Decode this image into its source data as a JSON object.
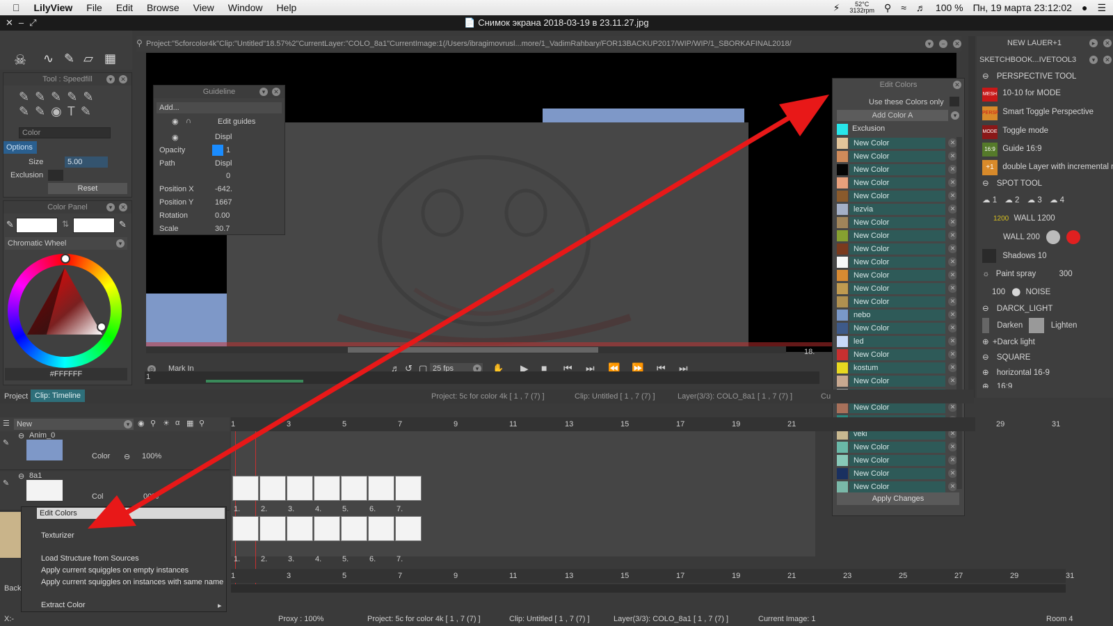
{
  "menubar": {
    "app": "LilyView",
    "menus": [
      "File",
      "Edit",
      "Browse",
      "View",
      "Window",
      "Help"
    ],
    "temp": "52°C",
    "rpm": "3132rpm",
    "battery": "100 %",
    "datetime": "Пн, 19 марта  23:12:02"
  },
  "window": {
    "title": "Снимок экрана 2018-03-19 в 23.11.27.jpg"
  },
  "pathbar": "Project:\"5cforcolor4k\"Clip:\"Untitled\"18.57%2\"CurrentLayer:\"COLO_8a1\"CurrentImage:1(/Users/ibragimovrusl...more/1_VadimRahbary/FOR13BACKUP2017/WIP/WIP/1_SBORKAFINAL2018/",
  "tool_panel": {
    "title": "Tool : Speedfill",
    "color_label": "Color",
    "options": "Options",
    "size_label": "Size",
    "size_value": "5.00",
    "exclusion_label": "Exclusion",
    "reset": "Reset"
  },
  "color_panel": {
    "title": "Color Panel",
    "wheel_mode": "Chromatic Wheel",
    "hex": "#FFFFFF"
  },
  "guideline": {
    "title": "Guideline",
    "add": "Add...",
    "edit_guides": "Edit guides",
    "displ": "Displ",
    "opacity_label": "Opacity",
    "opacity_val": "1",
    "path_label": "Path",
    "path_val": "Displ",
    "zero": "0",
    "posx_label": "Position X",
    "posx_val": "-642.",
    "posy_label": "Position Y",
    "posy_val": "1667",
    "rot_label": "Rotation",
    "rot_val": "0.00",
    "scale_label": "Scale",
    "scale_val": "30.7"
  },
  "edit_colors": {
    "title": "Edit Colors",
    "use_only": "Use these Colors only",
    "add_color": "Add Color A",
    "exclusion": "Exclusion",
    "exclusion_color": "#27e6ea",
    "apply": "Apply Changes",
    "colors": [
      {
        "name": "New Color",
        "swatch": "#e2c49a"
      },
      {
        "name": "New Color",
        "swatch": "#cf8a5a"
      },
      {
        "name": "New Color",
        "swatch": "#050505"
      },
      {
        "name": "New Color",
        "swatch": "#e8a07c"
      },
      {
        "name": "New Color",
        "swatch": "#8a5a2c"
      },
      {
        "name": "lezvia",
        "swatch": "#a4b0c8"
      },
      {
        "name": "New Color",
        "swatch": "#a0845a"
      },
      {
        "name": "New Color",
        "swatch": "#86a030"
      },
      {
        "name": "New Color",
        "swatch": "#7a3a1e"
      },
      {
        "name": "New Color",
        "swatch": "#f8f8f8"
      },
      {
        "name": "New Color",
        "swatch": "#d88a32"
      },
      {
        "name": "New Color",
        "swatch": "#c09a50"
      },
      {
        "name": "New Color",
        "swatch": "#b09050"
      },
      {
        "name": "nebo",
        "swatch": "#7a98c8"
      },
      {
        "name": "New Color",
        "swatch": "#3e5a8a"
      },
      {
        "name": "led",
        "swatch": "#c8d8f8"
      },
      {
        "name": "New Color",
        "swatch": "#c83030"
      },
      {
        "name": "kostum",
        "swatch": "#e8d820"
      },
      {
        "name": "New Color",
        "swatch": "#c8a890"
      },
      {
        "name": "New Color",
        "swatch": "#a8a8a8"
      },
      {
        "name": "New Color",
        "swatch": "#a8705a"
      },
      {
        "name": "New Color",
        "swatch": "#2a8a80"
      },
      {
        "name": "veki",
        "swatch": "#c8b890"
      },
      {
        "name": "New Color",
        "swatch": "#6ab8a8"
      },
      {
        "name": "New Color",
        "swatch": "#88c8b8"
      },
      {
        "name": "New Color",
        "swatch": "#1a3060"
      },
      {
        "name": "New Color",
        "swatch": "#7ab8a8"
      }
    ]
  },
  "right_panel": {
    "header1": "NEW LAUER+1",
    "header2": "SKETCHBOOK...IVETOOL3",
    "items": {
      "persp_tool": "PERSPECTIVE TOOL",
      "mode1010": "10-10 for MODE",
      "smart_toggle": "Smart Toggle Perspective",
      "toggle_mode": "Toggle mode",
      "guide169": "Guide 16:9",
      "double_layer": "double Layer with incremental n",
      "spot_tool": "SPOT TOOL",
      "s1": "1",
      "s2": "2",
      "s3": "3",
      "s4": "4",
      "wall1200": "WALL 1200",
      "wall200": "WALL 200",
      "shadows": "Shadows 10",
      "paint_spray": "Paint spray",
      "spray_val": "300",
      "n100": "100",
      "noise": "NOISE",
      "darck_light": "DARCK_LIGHT",
      "darken": "Darken",
      "lighten": "Lighten",
      "darck_light2": "+Darck light",
      "square": "SQUARE",
      "horizontal": "horizontal  16-9",
      "b169": "16:9"
    },
    "icons": {
      "mesh": "MESH",
      "persp": "PERSP",
      "mode": "MODE",
      "g169": "16:9",
      "layer1": "+1",
      "w1200": "1200"
    }
  },
  "playback": {
    "mark_in": "Mark In",
    "fps": "25 fps",
    "frame": "1",
    "zoom_right": "18."
  },
  "timeline": {
    "tabs": [
      "Project",
      "Clip: Timeline"
    ],
    "info_project": "Project: 5c for color 4k [ 1 , 7  (7) ]",
    "info_clip": "Clip: Untitled [ 1 , 7  (7) ]",
    "info_layer": "Layer(3/3): COLO_8a1 [ 1 , 7  (7) ]",
    "info_cu": "Cu",
    "new": "New",
    "layer_anim": "Anim_0",
    "layer_8a1": "8a1",
    "color_label": "Color",
    "percent": "100%",
    "percent2": "00%",
    "col_label": "Col",
    "top_numbers": [
      "1",
      "3",
      "5",
      "7",
      "9",
      "11",
      "13",
      "15",
      "17",
      "19",
      "21"
    ],
    "top_numbers_right": [
      "29",
      "31"
    ],
    "bottom_numbers": [
      "1",
      "3",
      "5",
      "7",
      "9",
      "11",
      "13",
      "15",
      "17",
      "19",
      "21",
      "23",
      "25",
      "27",
      "29",
      "31"
    ],
    "frame_labels": [
      "1.",
      "2.",
      "3.",
      "4.",
      "5.",
      "6.",
      "7."
    ],
    "back": "Back",
    "xcoord": "X:-"
  },
  "context_menu": {
    "edit_colors": "Edit Colors",
    "texturizer": "Texturizer",
    "load_structure": "Load Structure from Sources",
    "apply_empty": "Apply current squiggles on empty instances",
    "apply_same": "Apply current squiggles on instances with same name",
    "extract": "Extract Color"
  },
  "statusbar": {
    "proxy": "Proxy : 100%",
    "project": "Project: 5c for color 4k [ 1 , 7  (7) ]",
    "clip": "Clip: Untitled [ 1 , 7  (7) ]",
    "layer": "Layer(3/3): COLO_8a1 [ 1 , 7  (7) ]",
    "current_image": "Current Image: 1",
    "room": "Room 4"
  }
}
